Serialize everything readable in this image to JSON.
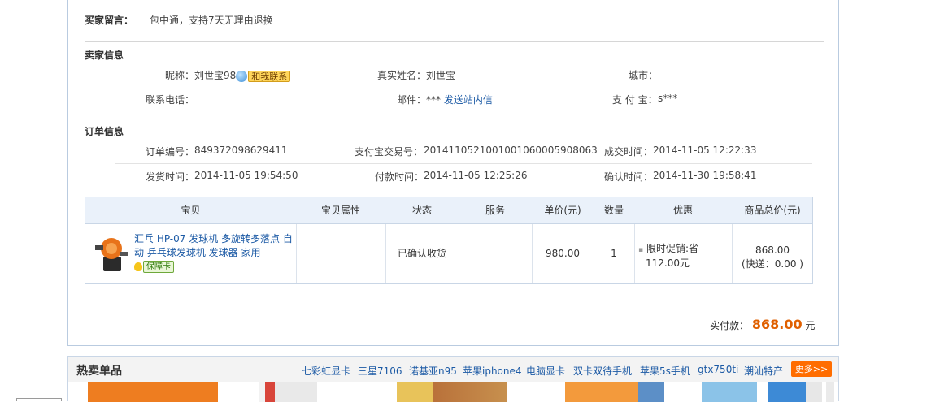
{
  "buyer_message": {
    "label": "买家留言：",
    "value": "包中通，支持7天无理由退换"
  },
  "seller": {
    "section_title": "卖家信息",
    "nickname_label": "昵称：",
    "nickname": "刘世宝98",
    "contact_btn": "和我联系",
    "realname_label": "真实姓名：",
    "realname": "刘世宝",
    "city_label": "城市：",
    "phone_label": "联系电话：",
    "email_label": "邮件：",
    "email_mask": "***",
    "send_msg": "发送站内信",
    "alipay_label": "支 付 宝：",
    "alipay": "s***"
  },
  "order": {
    "section_title": "订单信息",
    "order_no_label": "订单编号：",
    "order_no": "849372098629411",
    "alipay_trade_label": "支付宝交易号：",
    "alipay_trade": "2014110521001001060005908063",
    "deal_time_label": "成交时间：",
    "deal_time": "2014-11-05 12:22:33",
    "ship_time_label": "发货时间：",
    "ship_time": "2014-11-05 19:54:50",
    "pay_time_label": "付款时间：",
    "pay_time": "2014-11-05 12:25:26",
    "confirm_time_label": "确认时间：",
    "confirm_time": "2014-11-30 19:58:41"
  },
  "table": {
    "headers": [
      "宝贝",
      "宝贝属性",
      "状态",
      "服务",
      "单价(元)",
      "数量",
      "优惠",
      "商品总价(元)"
    ],
    "item": {
      "title": "汇乓 HP-07 发球机 多旋转多落点 自动 乒乓球发球机 发球器 家用",
      "badge": "保障卡",
      "attrs": "",
      "status": "已确认收货",
      "service": "",
      "price": "980.00",
      "qty": "1",
      "discount_line1": "限时促销:省",
      "discount_line2": "112.00元",
      "total": "868.00",
      "shipping": "(快递：0.00 )"
    }
  },
  "payment": {
    "label": "实付款：",
    "amount": "868.00",
    "unit": "元"
  },
  "hot": {
    "title": "热卖单品",
    "links": [
      "七彩虹显卡",
      "三星7106",
      "诺基亚n95",
      "苹果iphone4",
      "电脑显卡",
      "双卡双待手机",
      "苹果5s手机",
      "gtx750ti",
      "潮汕特产"
    ],
    "more": "更多>>"
  },
  "colors": {
    "accent": "#e06000",
    "link": "#1c5aa5",
    "more_bg": "#ff6d00",
    "table_head": "#eaf1fa"
  }
}
